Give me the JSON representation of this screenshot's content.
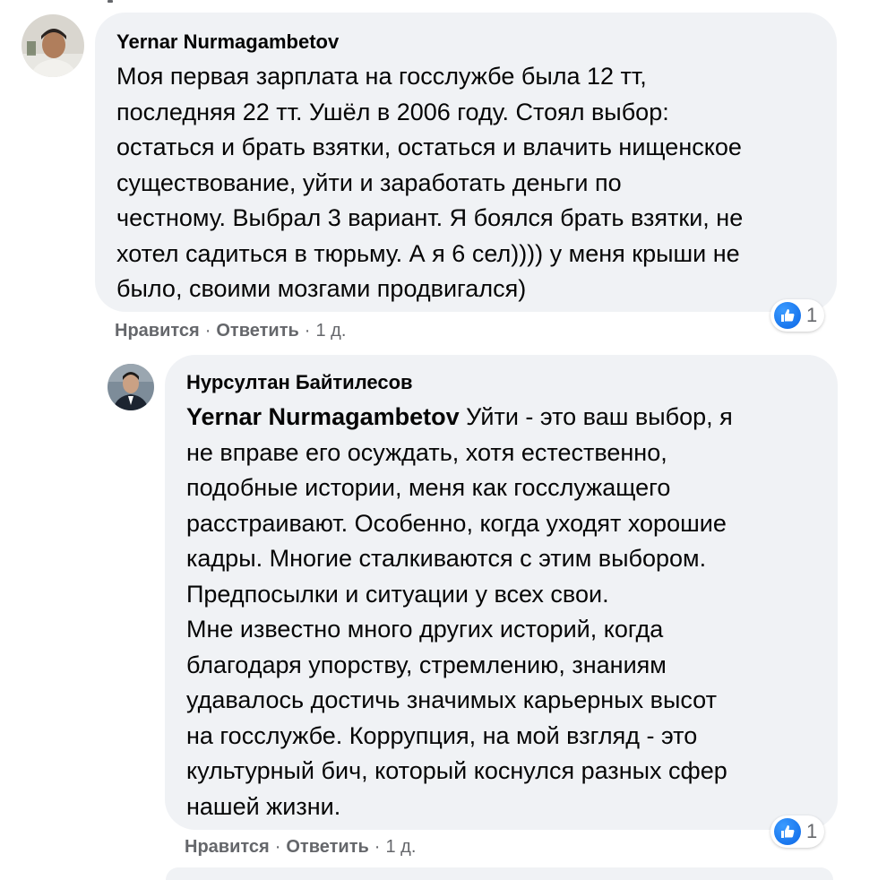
{
  "comments": [
    {
      "author": "Yernar Nurmagambetov",
      "text": "Моя первая зарплата на госслужбе была 12 тт,\nпоследняя 22 тт. Ушёл в 2006 году. Стоял выбор:\nостаться и брать взятки, остаться и влачить нищенское\nсуществование, уйти и заработать деньги по\nчестному. Выбрал 3 вариант. Я боялся брать взятки, не\nхотел садиться в тюрьму. А я 6 сел)))) у меня крыши не\nбыло, своими мозгами продвигался)",
      "reaction_count": "1",
      "like_label": "Нравится",
      "reply_label": "Ответить",
      "time": "1 д."
    },
    {
      "author": "Нурсултан Байтилесов",
      "mention": "Yernar Nurmagambetov",
      "text": " Уйти - это ваш выбор, я\nне вправе его осуждать, хотя естественно,\nподобные истории, меня как госслужащего\nрасстраивают. Особенно, когда уходят хорошие\nкадры. Многие сталкиваются с этим выбором.\nПредпосылки и ситуации у всех свои.\nМне известно много других историй, когда\nблагодаря упорству, стремлению, знаниям\nудавалось достичь значимых карьерных высот\nна госслужбе. Коррупция, на мой взгляд - это\nкультурный бич, который коснулся разных сфер\nнашей жизни.",
      "reaction_count": "1",
      "like_label": "Нравится",
      "reply_label": "Ответить",
      "time": "1 д."
    }
  ],
  "separator": "·",
  "colors": {
    "bubble": "#f0f2f5",
    "meta_text": "#65676b",
    "like_blue": "#0a66e6"
  },
  "icons": [
    "like-icon"
  ]
}
